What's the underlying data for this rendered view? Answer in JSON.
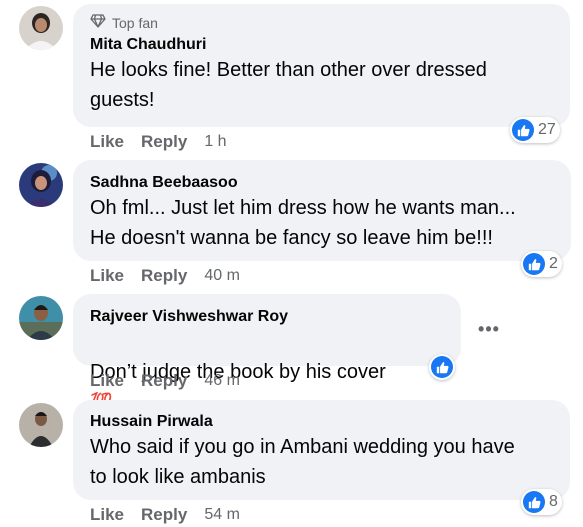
{
  "comments": [
    {
      "badge": "Top fan",
      "name": "Mita Chaudhuri",
      "text": "He looks fine! Better than other over dressed\nguests!",
      "like": "Like",
      "reply": "Reply",
      "time": "1 h",
      "reactions": "27"
    },
    {
      "name": "Sadhna Beebaasoo",
      "text": "Oh fml... Just let him dress how he wants man...\nHe doesn't wanna be fancy so leave him be!!!",
      "like": "Like",
      "reply": "Reply",
      "time": "40 m",
      "reactions": "2"
    },
    {
      "name": "Rajveer Vishweshwar Roy",
      "text": "Don’t judge the book by his cover",
      "emoji": "💯",
      "like": "Like",
      "reply": "Reply",
      "time": "46 m",
      "more": "•••"
    },
    {
      "name": "Hussain Pirwala",
      "text": "Who said if you go in Ambani wedding you have\nto look like ambanis",
      "like": "Like",
      "reply": "Reply",
      "time": "54 m",
      "reactions": "8"
    }
  ],
  "colors": {
    "like_blue": "#1877f2",
    "bubble": "#f0f2f5",
    "meta": "#65676b"
  }
}
